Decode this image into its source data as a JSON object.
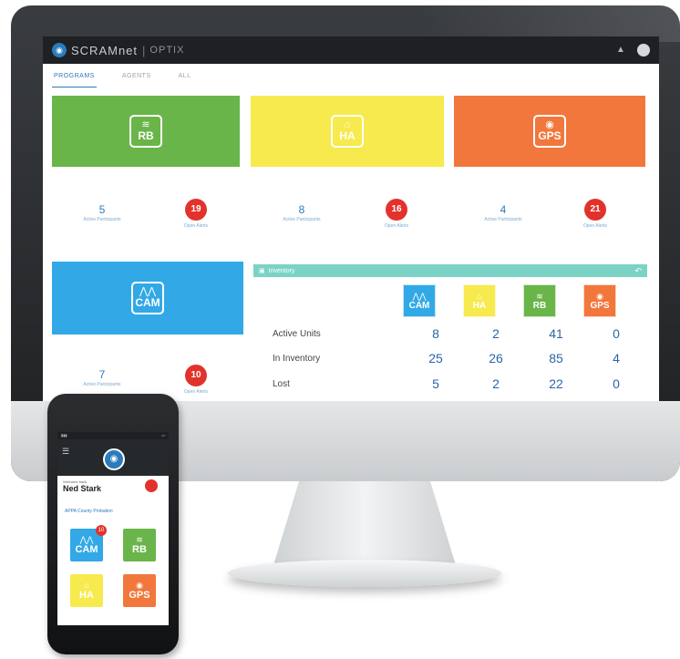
{
  "desktop": {
    "brand": {
      "name": "SCRAMnet",
      "product": "OPTIX"
    },
    "tabs": [
      {
        "label": "PROGRAMS"
      },
      {
        "label": "AGENTS"
      },
      {
        "label": "ALL"
      }
    ],
    "programs": [
      {
        "code": "RB",
        "icon": "wind-icon",
        "color": "#6ab54a",
        "participants": "5",
        "participants_label": "Active Participants",
        "alerts": "19",
        "alerts_label": "Open Alerts"
      },
      {
        "code": "HA",
        "icon": "house-icon",
        "color": "#f6ea4e",
        "participants": "8",
        "participants_label": "Active Participants",
        "alerts": "16",
        "alerts_label": "Open Alerts"
      },
      {
        "code": "GPS",
        "icon": "map-pin-icon",
        "color": "#f2773c",
        "participants": "4",
        "participants_label": "Active Participants",
        "alerts": "21",
        "alerts_label": "Open Alerts"
      },
      {
        "code": "CAM",
        "icon": "mountain-icon",
        "color": "#32a9e6",
        "participants": "7",
        "participants_label": "Active Participants",
        "alerts": "10",
        "alerts_label": "Open Alerts"
      }
    ],
    "inventory": {
      "title": "Inventory",
      "columns": [
        {
          "code": "CAM",
          "icon": "mountain-icon",
          "color": "#32a9e6"
        },
        {
          "code": "HA",
          "icon": "house-icon",
          "color": "#f6ea4e"
        },
        {
          "code": "RB",
          "icon": "wind-icon",
          "color": "#6ab54a"
        },
        {
          "code": "GPS",
          "icon": "map-pin-icon",
          "color": "#f2773c"
        }
      ],
      "rows": [
        {
          "label": "Active Units",
          "values": [
            "8",
            "2",
            "41",
            "0"
          ]
        },
        {
          "label": "In Inventory",
          "values": [
            "25",
            "26",
            "85",
            "4"
          ]
        },
        {
          "label": "Lost",
          "values": [
            "5",
            "2",
            "22",
            "0"
          ]
        }
      ]
    }
  },
  "phone": {
    "welcome": "Welcome back,",
    "user_name": "Ned Stark",
    "agency": "APPA County Probation",
    "tiles": [
      {
        "code": "CAM",
        "color": "#32a9e6",
        "badge": "10"
      },
      {
        "code": "RB",
        "color": "#6ab54a",
        "badge": ""
      },
      {
        "code": "HA",
        "color": "#f6ea4e",
        "badge": ""
      },
      {
        "code": "GPS",
        "color": "#f2773c",
        "badge": ""
      }
    ]
  }
}
